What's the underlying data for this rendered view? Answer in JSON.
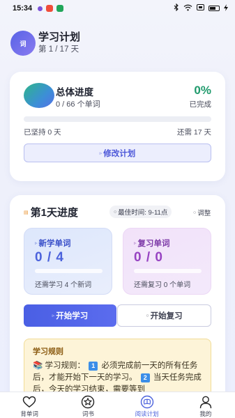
{
  "status_bar": {
    "time": "15:34",
    "app_icon_colors": [
      "#7b53d8",
      "#f04d3a",
      "#21a65a"
    ]
  },
  "header": {
    "avatar_text": "词",
    "title": "学习计划",
    "subtitle": "第 1 / 17 天"
  },
  "overall": {
    "title": "总体进度",
    "count": "0 / 66 个单词",
    "percent": "0%",
    "percent_value": 0,
    "done_label": "已完成",
    "days_kept": "已坚持 0 天",
    "days_remaining": "还需 17 天",
    "edit_button": "修改计划"
  },
  "day": {
    "title": "第1天进度",
    "best_time": "最佳时间: 9-11点",
    "adjust": "调整",
    "new_words": {
      "label": "新学单词",
      "value": "0 / 4",
      "progress": 0,
      "note": "还需学习 4 个新词"
    },
    "review_words": {
      "label": "复习单词",
      "value": "0 / 0",
      "progress": 0,
      "note": "还需复习 0 个单词"
    },
    "start_learn": "开始学习",
    "start_review": "开始复习"
  },
  "rules": {
    "title": "学习规则",
    "intro": "学习规则：",
    "badge1": "1",
    "rule1": "必须完成前一天的所有任务后，才能开始下一天的学习。",
    "badge2": "2",
    "rule2": "当天任务完成后，今天的学习结束，需要等到"
  },
  "nav": [
    {
      "label": "背单词",
      "icon": "heart-icon",
      "active": false
    },
    {
      "label": "词书",
      "icon": "star-icon",
      "active": false
    },
    {
      "label": "阅读计划",
      "icon": "reading-plan-icon",
      "active": true
    },
    {
      "label": "我的",
      "icon": "person-icon",
      "active": false
    }
  ],
  "colors": {
    "accent": "#4b62dc",
    "success": "#1f9a6c",
    "review": "#9743c2"
  }
}
